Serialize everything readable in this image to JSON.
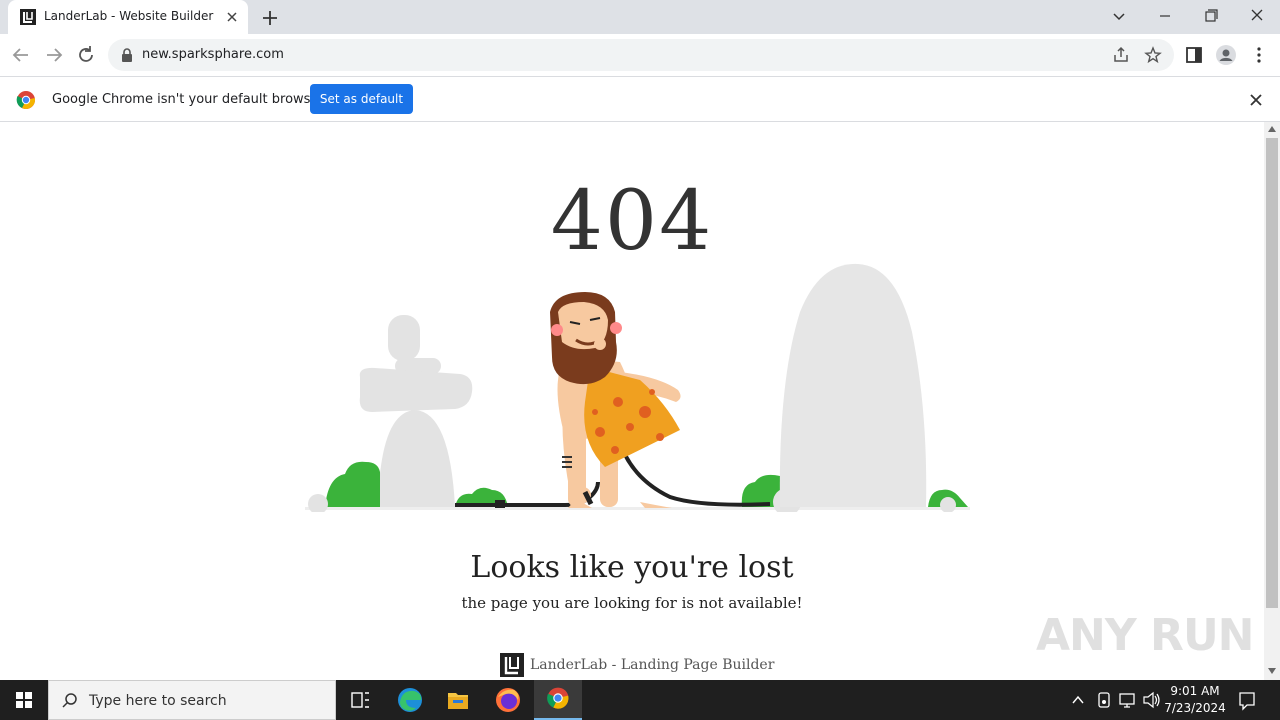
{
  "browser": {
    "tab_title": "LanderLab - Website Builder",
    "url": "new.sparksphare.com"
  },
  "infobar": {
    "message": "Google Chrome isn't your default browser",
    "button_label": "Set as default"
  },
  "page": {
    "error_code": "404",
    "headline": "Looks like you're lost",
    "subline": "the page you are looking for is not available!",
    "footer_text": "LanderLab - Landing Page Builder",
    "watermark": "ANY RUN"
  },
  "taskbar": {
    "search_placeholder": "Type here to search",
    "time": "9:01 AM",
    "date": "7/23/2024"
  },
  "colors": {
    "accent_blue": "#1a73e8",
    "bush_green": "#3bb33b",
    "skin": "#f7c9a0",
    "spot_orange": "#f0a020",
    "rock_grey": "#e6e6e6"
  }
}
